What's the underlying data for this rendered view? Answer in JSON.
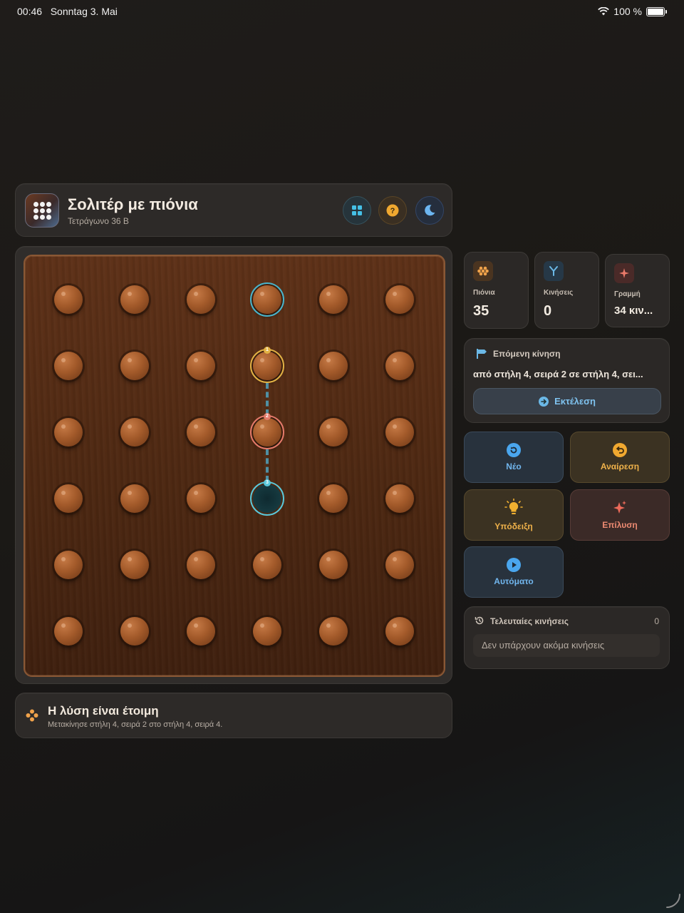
{
  "status_bar": {
    "time": "00:46",
    "date": "Sonntag 3. Mai",
    "battery": "100 %"
  },
  "header": {
    "title": "Σολιτέρ με πιόνια",
    "subtitle": "Τετράγωνο 36 Β"
  },
  "board": {
    "rows": 6,
    "cols": 6,
    "highlights": [
      {
        "col": 4,
        "row": 1,
        "type": "selected"
      },
      {
        "col": 4,
        "row": 2,
        "type": "step",
        "badge": "1"
      },
      {
        "col": 4,
        "row": 3,
        "type": "step",
        "badge": "2"
      },
      {
        "col": 4,
        "row": 4,
        "type": "target-hole",
        "badge": "3"
      }
    ],
    "empty_holes": [
      {
        "col": 4,
        "row": 4
      }
    ]
  },
  "solution": {
    "title": "Η λύση είναι έτοιμη",
    "text": "Μετακίνησε στήλη 4, σειρά 2 στο στήλη 4, σειρά 4."
  },
  "stats": [
    {
      "label": "Πιόνια",
      "value": "35",
      "icon": "pegs-icon",
      "color": "#f0a24a"
    },
    {
      "label": "Κινήσεις",
      "value": "0",
      "icon": "moves-icon",
      "color": "#6bb8e6"
    },
    {
      "label": "Γραμμή",
      "value": "34 κιν...",
      "icon": "sparkle-icon",
      "color": "#ec7a6a"
    }
  ],
  "next_move": {
    "heading": "Επόμενη κίνηση",
    "text": "από στήλη 4, σειρά 2 σε στήλη 4, σει...",
    "execute_label": "Εκτέλεση"
  },
  "actions": {
    "new": "Νέο",
    "undo": "Αναίρεση",
    "hint": "Υπόδειξη",
    "solve": "Επίλυση",
    "auto": "Αυτόματο"
  },
  "recent": {
    "title": "Τελευταίες κινήσεις",
    "count": "0",
    "empty": "Δεν υπάρχουν ακόμα κινήσεις"
  },
  "colors": {
    "accent_blue": "#6bb8e6",
    "accent_amber": "#f0b24a",
    "accent_red": "#ec8a72",
    "board_wood": "#5e3118"
  }
}
